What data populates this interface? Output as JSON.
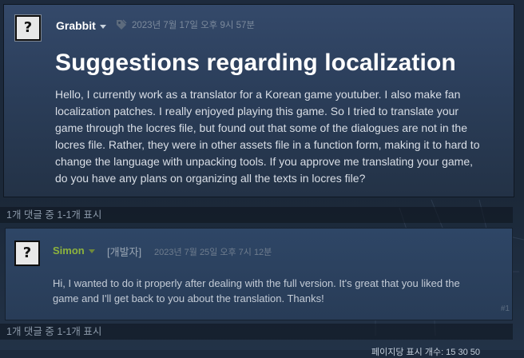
{
  "original_post": {
    "author": "Grabbit",
    "timestamp": "2023년 7월 17일 오후 9시 57분",
    "avatar_glyph": "?",
    "title": "Suggestions regarding localization",
    "body": "Hello, I currently work as a translator for a Korean game youtuber. I also make fan\nlocalization patches. I really enjoyed playing this game. So I tried to translate your\ngame through the locres file, but found out that some of the dialogues are not in the\nlocres file. Rather, they were in other assets file in a function form, making it to hard to\nchange the language with unpacking tools. If you approve me translating your game,\ndo you have any plans on organizing all the texts in locres file?"
  },
  "comments_count_top": "1개 댓글 중 1-1개 표시",
  "comments": [
    {
      "author": "Simon",
      "badge": "[개발자]",
      "timestamp": "2023년 7월 25일 오후 7시 12분",
      "avatar_glyph": "?",
      "text": "Hi, I wanted to do it properly after dealing with the full version. It's great that you liked the\ngame and I'll get back to you about the translation. Thanks!",
      "index": "#1"
    }
  ],
  "comments_count_bottom": "1개 댓글 중 1-1개 표시",
  "footer_partial": "페이지당 표시 개수: 15 30 50",
  "colors": {
    "dev_name": "#8db33d",
    "title": "#ffffff",
    "body_text": "#d9dee6"
  }
}
